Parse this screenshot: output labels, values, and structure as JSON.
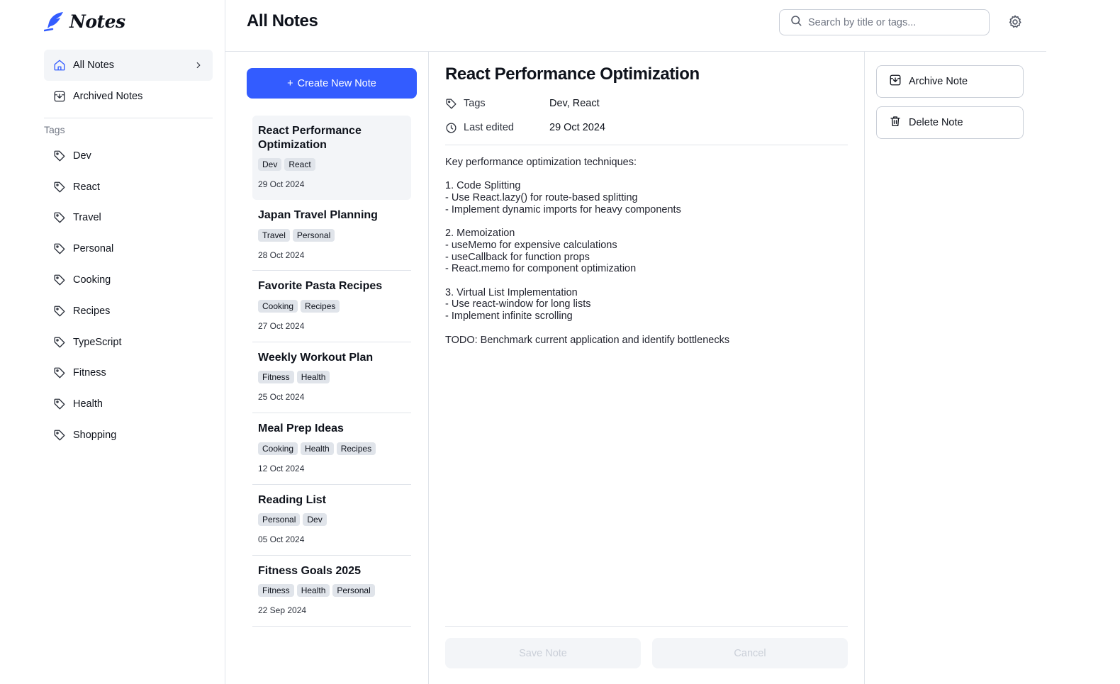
{
  "app": {
    "name": "Notes",
    "accent": "#335cff"
  },
  "sidebar": {
    "nav": [
      {
        "label": "All Notes",
        "icon": "home-icon",
        "active": true
      },
      {
        "label": "Archived Notes",
        "icon": "archive-icon",
        "active": false
      }
    ],
    "tags_title": "Tags",
    "tags": [
      "Dev",
      "React",
      "Travel",
      "Personal",
      "Cooking",
      "Recipes",
      "TypeScript",
      "Fitness",
      "Health",
      "Shopping"
    ]
  },
  "header": {
    "title": "All Notes",
    "search_placeholder": "Search by title or tags..."
  },
  "list": {
    "create_label": "Create New Note",
    "notes": [
      {
        "title": "React Performance Optimization",
        "tags": [
          "Dev",
          "React"
        ],
        "date": "29 Oct 2024",
        "selected": true
      },
      {
        "title": "Japan Travel Planning",
        "tags": [
          "Travel",
          "Personal"
        ],
        "date": "28 Oct 2024"
      },
      {
        "title": "Favorite Pasta Recipes",
        "tags": [
          "Cooking",
          "Recipes"
        ],
        "date": "27 Oct 2024"
      },
      {
        "title": "Weekly Workout Plan",
        "tags": [
          "Fitness",
          "Health"
        ],
        "date": "25 Oct 2024"
      },
      {
        "title": "Meal Prep Ideas",
        "tags": [
          "Cooking",
          "Health",
          "Recipes"
        ],
        "date": "12 Oct 2024"
      },
      {
        "title": "Reading List",
        "tags": [
          "Personal",
          "Dev"
        ],
        "date": "05 Oct 2024"
      },
      {
        "title": "Fitness Goals 2025",
        "tags": [
          "Fitness",
          "Health",
          "Personal"
        ],
        "date": "22 Sep 2024"
      }
    ]
  },
  "detail": {
    "title": "React Performance Optimization",
    "tags_label": "Tags",
    "tags_value": "Dev, React",
    "edited_label": "Last edited",
    "edited_value": "29 Oct 2024",
    "content": "Key performance optimization techniques:\n\n1. Code Splitting\n- Use React.lazy() for route-based splitting\n- Implement dynamic imports for heavy components\n\n2. Memoization\n- useMemo for expensive calculations\n- useCallback for function props\n- React.memo for component optimization\n\n3. Virtual List Implementation\n- Use react-window for long lists\n- Implement infinite scrolling\n\nTODO: Benchmark current application and identify bottlenecks",
    "save_label": "Save Note",
    "cancel_label": "Cancel"
  },
  "actions": {
    "archive_label": "Archive Note",
    "delete_label": "Delete Note"
  }
}
